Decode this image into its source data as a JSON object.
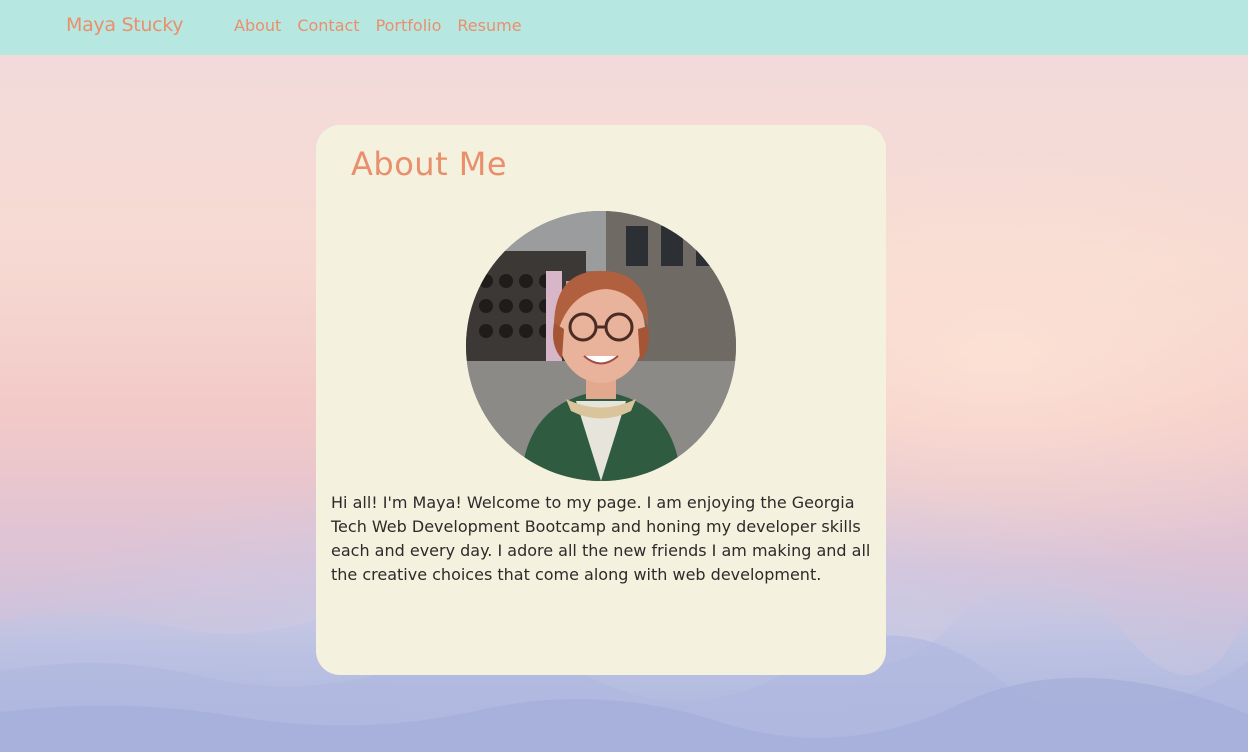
{
  "navbar": {
    "brand": "Maya Stucky",
    "links": [
      {
        "label": "About"
      },
      {
        "label": "Contact"
      },
      {
        "label": "Portfolio"
      },
      {
        "label": "Resume"
      }
    ],
    "background_color": "#b6e8e1",
    "accent_color": "#ea8f6c"
  },
  "about": {
    "title": "About Me",
    "photo_icon": "profile-photo",
    "bio": "Hi all! I'm Maya! Welcome to my page. I am enjoying the Georgia Tech Web Development Bootcamp and honing my developer skills each and every day. I adore all the new friends I am making and all the creative choices that come along with web development.",
    "card_color": "#f4f1de"
  }
}
